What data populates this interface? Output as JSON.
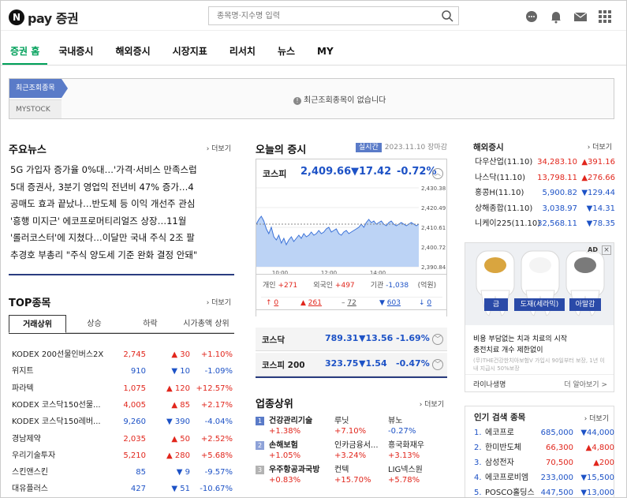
{
  "header": {
    "logo_letter": "N",
    "logo_text": "pay 증권",
    "search_placeholder": "종목명·지수명 입력"
  },
  "nav": [
    {
      "label": "증권 홈"
    },
    {
      "label": "국내증시"
    },
    {
      "label": "해외증시"
    },
    {
      "label": "시장지표"
    },
    {
      "label": "리서치"
    },
    {
      "label": "뉴스"
    },
    {
      "label": "MY"
    }
  ],
  "recent": {
    "tab": "최근조회종목",
    "mystock": "MYSTOCK",
    "empty_msg": "최근조회종목이 없습니다"
  },
  "news": {
    "title": "주요뉴스",
    "more": "더보기",
    "items": [
      "5G 가입자 증가율 0%대…'가격·서비스 만족스럽",
      "5대 증권사, 3분기 영업익 전년비 47% 증가…4",
      "공매도 효과 끝났나…반도체 등 이익 개선주 관심",
      "'흥행 미지근' 에코프로머티리얼즈 상장…11월 ",
      "'롤러코스터'에 지쳤다…이달만 국내 주식 2조 팔",
      "추경호 부총리 \"주식 양도세 기준 완화 결정 안돼\""
    ]
  },
  "top": {
    "title": "TOP종목",
    "more": "더보기",
    "tabs": [
      "거래상위",
      "상승",
      "하락",
      "시가총액 상위"
    ],
    "rows": [
      {
        "name": "KODEX 200선물인버스2X",
        "price": "2,745",
        "arrow": "▲",
        "change": "30",
        "pct": "+1.10%",
        "dir": "up"
      },
      {
        "name": "위지트",
        "price": "910",
        "arrow": "▼",
        "change": "10",
        "pct": "-1.09%",
        "dir": "down"
      },
      {
        "name": "파라텍",
        "price": "1,075",
        "arrow": "▲",
        "change": "120",
        "pct": "+12.57%",
        "dir": "up"
      },
      {
        "name": "KODEX 코스닥150선물...",
        "price": "4,005",
        "arrow": "▲",
        "change": "85",
        "pct": "+2.17%",
        "dir": "up"
      },
      {
        "name": "KODEX 코스닥150레버...",
        "price": "9,260",
        "arrow": "▼",
        "change": "390",
        "pct": "-4.04%",
        "dir": "down"
      },
      {
        "name": "경남제약",
        "price": "2,035",
        "arrow": "▲",
        "change": "50",
        "pct": "+2.52%",
        "dir": "up"
      },
      {
        "name": "우리기술투자",
        "price": "5,210",
        "arrow": "▲",
        "change": "280",
        "pct": "+5.68%",
        "dir": "up"
      },
      {
        "name": "스킨앤스킨",
        "price": "85",
        "arrow": "▼",
        "change": "9",
        "pct": "-9.57%",
        "dir": "down"
      },
      {
        "name": "대유플러스",
        "price": "427",
        "arrow": "▼",
        "change": "51",
        "pct": "-10.67%",
        "dir": "down"
      }
    ]
  },
  "today": {
    "title": "오늘의 증시",
    "realtime": "실시간",
    "date": "2023.11.10",
    "status": "장마감",
    "kospi": {
      "name": "코스피",
      "value": "2,409.66",
      "change": "▼17.42",
      "pct": "-0.72%"
    },
    "chart_y_ticks": [
      "2,430.38",
      "2,420.49",
      "2,410.61",
      "2,400.72",
      "2,390.84"
    ],
    "chart_x_ticks": [
      "10:00",
      "12:00",
      "14:00"
    ],
    "investor": {
      "personal_label": "개인",
      "personal": "+271",
      "foreign_label": "외국인",
      "foreign": "+497",
      "inst_label": "기관",
      "inst": "-1,038",
      "unit": "(억원)",
      "up_limit": "0",
      "up": "261",
      "flat": "72",
      "down": "603",
      "down_limit": "0"
    },
    "kosdaq": {
      "name": "코스닥",
      "value": "789.31",
      "change": "▼13.56",
      "pct": "-1.69%"
    },
    "kospi200": {
      "name": "코스피 200",
      "value": "323.75",
      "change": "▼1.54",
      "pct": "-0.47%"
    }
  },
  "sector": {
    "title": "업종상위",
    "more": "더보기",
    "rows": [
      {
        "rank": "1",
        "rank_color": "#5a7bc8",
        "a": "건강관리기술",
        "ap": "+1.38%",
        "b": "루닛",
        "bp": "+7.10%",
        "c": "뷰노",
        "cp": "-0.27%",
        "cdir": "down"
      },
      {
        "rank": "2",
        "rank_color": "#8ea2d8",
        "a": "손해보험",
        "ap": "+1.05%",
        "b": "인카금융서...",
        "bp": "+3.24%",
        "c": "흥국화재우",
        "cp": "+3.13%",
        "cdir": "up"
      },
      {
        "rank": "3",
        "rank_color": "#b3b3b3",
        "a": "우주항공과국방",
        "ap": "+0.83%",
        "b": "컨텍",
        "bp": "+15.70%",
        "c": "LIG넥스원",
        "cp": "+5.78%",
        "cdir": "up"
      }
    ]
  },
  "overseas": {
    "title": "해외증시",
    "more": "더보기",
    "rows": [
      {
        "name": "다우산업(11.10)",
        "value": "34,283.10",
        "change": "▲391.16",
        "dir": "up"
      },
      {
        "name": "나스닥(11.10)",
        "value": "13,798.11",
        "change": "▲276.66",
        "dir": "up"
      },
      {
        "name": "홍콩H(11.10)",
        "value": "5,900.82",
        "change": "▼129.44",
        "dir": "down"
      },
      {
        "name": "상해종합(11.10)",
        "value": "3,038.97",
        "change": "▼14.31",
        "dir": "down"
      },
      {
        "name": "니케이225(11.10)",
        "value": "32,568.11",
        "change": "▼78.35",
        "dir": "down"
      }
    ]
  },
  "ad": {
    "badge": "AD",
    "labels": [
      "금",
      "도재(세라믹)",
      "아말감"
    ],
    "line1": "비용 부담없는 치과 치료의 시작",
    "line2": "충전치료 개수 제한없이",
    "line3": "(무)THE건강한치아보험V 가입시 90일부터 보장, 1년 이내 지급시 50%보장",
    "brand": "라이나생명",
    "more": "더 알아보기 >"
  },
  "popular": {
    "title": "인기 검색 종목",
    "more": "더보기",
    "rows": [
      {
        "rank": "1.",
        "name": "에코프로",
        "value": "685,000",
        "change": "▼44,000",
        "dir": "down"
      },
      {
        "rank": "2.",
        "name": "한미반도체",
        "value": "66,300",
        "change": "▲4,800",
        "dir": "up"
      },
      {
        "rank": "3.",
        "name": "삼성전자",
        "value": "70,500",
        "change": "▲200",
        "dir": "up"
      },
      {
        "rank": "4.",
        "name": "에코프로비엠",
        "value": "233,000",
        "change": "▼15,500",
        "dir": "down"
      },
      {
        "rank": "5.",
        "name": "POSCO홀딩스",
        "value": "447,500",
        "change": "▼13,000",
        "dir": "down"
      }
    ]
  },
  "colors": {
    "brand": "#00a05a",
    "up": "#e1261c",
    "down": "#1d52c6",
    "accent": "#5a7bc8"
  }
}
